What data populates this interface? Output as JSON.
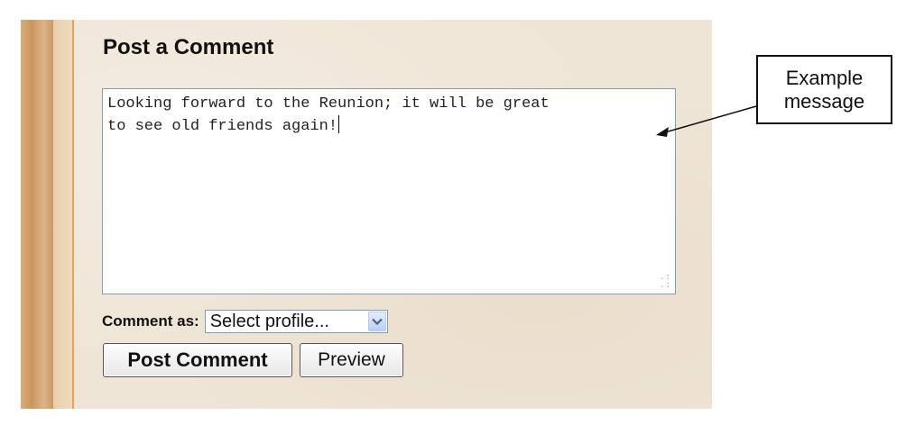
{
  "comment_form": {
    "heading": "Post a Comment",
    "message_line1": "Looking forward to the Reunion; it will be great",
    "message_line2": "to see old friends again!",
    "comment_as_label": "Comment as:",
    "profile_select_value": "Select profile...",
    "post_button_label": "Post Comment",
    "preview_button_label": "Preview"
  },
  "annotation": {
    "line1": "Example",
    "line2": "message"
  },
  "icons": {
    "select_arrow": "chevron-down-icon",
    "resize_grip": "resize-grip-icon"
  },
  "colors": {
    "panel_background": "#efe5d6",
    "accent_border": "#e8a35a",
    "input_border": "#7f9db9"
  }
}
